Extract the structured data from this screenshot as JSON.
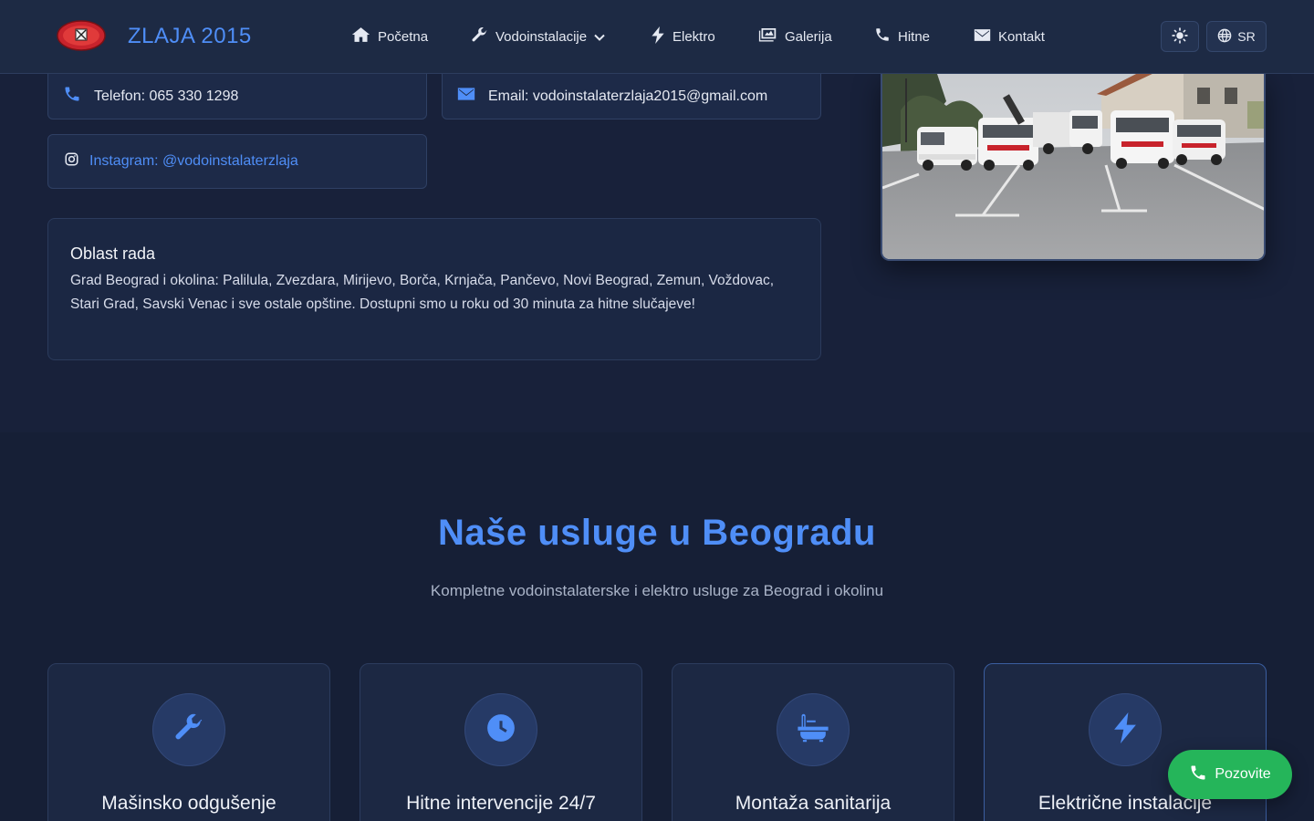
{
  "brand": {
    "name": "ZLAJA 2015",
    "logo_icon": "zlaja-logo"
  },
  "nav": {
    "items": [
      {
        "label": "Početna",
        "icon": "home-icon"
      },
      {
        "label": "Vodoinstalacije",
        "icon": "wrench-icon",
        "dropdown": true
      },
      {
        "label": "Elektro",
        "icon": "bolt-icon"
      },
      {
        "label": "Galerija",
        "icon": "images-icon"
      },
      {
        "label": "Hitne",
        "icon": "phone-icon"
      },
      {
        "label": "Kontakt",
        "icon": "envelope-icon"
      }
    ],
    "theme_toggle_icon": "sun-icon",
    "language": {
      "label": "SR",
      "icon": "globe-icon"
    }
  },
  "contact": {
    "phone": "Telefon: 065 330 1298",
    "email": "Email: vodoinstalaterzlaja2015@gmail.com",
    "instagram": "Instagram: @vodoinstalaterzlaja"
  },
  "area": {
    "title": "Oblast rada",
    "text": "Grad Beograd i okolina: Palilula, Zvezdara, Mirijevo, Borča, Krnjača, Pančevo, Novi Beograd, Zemun, Voždovac, Stari Grad, Savski Venac i sve ostale opštine. Dostupni smo u roku od 30 minuta za hitne slučajeve!"
  },
  "services": {
    "title": "Naše usluge u Beogradu",
    "subtitle": "Kompletne vodoinstalaterske i elektro usluge za Beograd i okolinu",
    "items": [
      {
        "title": "Mašinsko odgušenje",
        "icon": "wrench-icon"
      },
      {
        "title": "Hitne intervencije 24/7",
        "icon": "clock-icon"
      },
      {
        "title": "Montaža sanitarija",
        "icon": "bath-icon"
      },
      {
        "title": "Električne instalacije",
        "icon": "bolt-icon"
      }
    ]
  },
  "floating_call": {
    "label": "Pozovite",
    "icon": "phone-icon"
  },
  "colors": {
    "accent": "#4f8ef7",
    "background": "#18213a",
    "navbar": "#1d2a44",
    "card": "#1d2a48",
    "call_button": "#25b55a"
  }
}
